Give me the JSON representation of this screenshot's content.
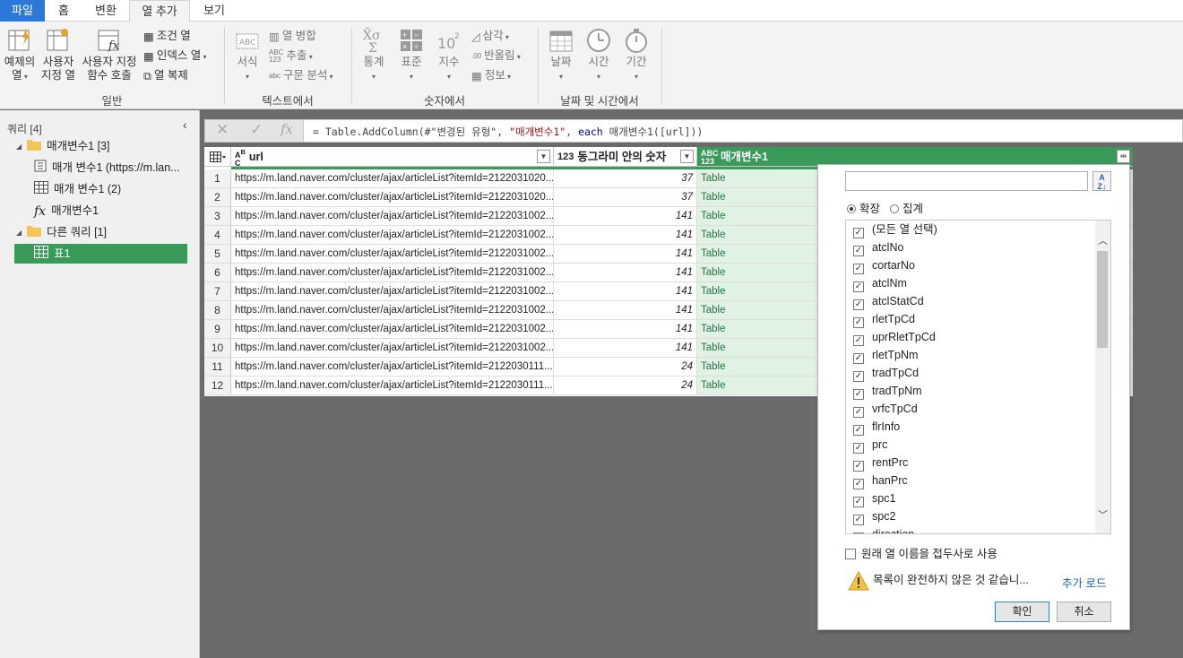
{
  "tabs": [
    {
      "label": "파일"
    },
    {
      "label": "홈"
    },
    {
      "label": "변환"
    },
    {
      "label": "열 추가"
    },
    {
      "label": "보기"
    }
  ],
  "ribbon": {
    "general": {
      "example_col": "예제의\n열",
      "custom_col": "사용자\n지정 열",
      "invoke_fn": "사용자 지정\n함수 호출",
      "conditional": "조건 열",
      "index": "인덱스 열",
      "duplicate": "열 복제",
      "label": "일반"
    },
    "text": {
      "format": "서식",
      "merge": "열 병합",
      "extract": "추출",
      "parse": "구문 분석",
      "label": "텍스트에서"
    },
    "number": {
      "stats": "통계",
      "standard": "표준",
      "scientific": "지수",
      "trig": "삼각",
      "rounding": "반올림",
      "info": "정보",
      "label": "숫자에서"
    },
    "datetime": {
      "date": "날짜",
      "time": "시간",
      "duration": "기간",
      "label": "날짜 및 시간에서"
    }
  },
  "queries": {
    "title": "쿼리 [4]",
    "groups": [
      {
        "label": "매개변수1 [3]"
      },
      {
        "label": "다른 쿼리 [1]"
      }
    ],
    "items": [
      {
        "label": "매개 변수1 (https://m.lan..."
      },
      {
        "label": "매개 변수1 (2)"
      },
      {
        "label": "매개변수1"
      },
      {
        "label": "표1"
      }
    ]
  },
  "formula": {
    "p1": "= Table.AddColumn(#\"변경된 유형\", ",
    "p2": "\"매개변수1\"",
    "p3": ", ",
    "p4": "each",
    "p5": " 매개변수1([url]))"
  },
  "table": {
    "columns": [
      {
        "type": "ABC",
        "name": "url"
      },
      {
        "type": "123",
        "name": "동그라미 안의 숫자"
      },
      {
        "type": "ABC 123",
        "name": "매개변수1"
      }
    ],
    "rows": [
      {
        "n": "1",
        "url": "https://m.land.naver.com/cluster/ajax/articleList?itemId=2122031020...",
        "num": "37",
        "val": "Table"
      },
      {
        "n": "2",
        "url": "https://m.land.naver.com/cluster/ajax/articleList?itemId=2122031020...",
        "num": "37",
        "val": "Table"
      },
      {
        "n": "3",
        "url": "https://m.land.naver.com/cluster/ajax/articleList?itemId=2122031002...",
        "num": "141",
        "val": "Table"
      },
      {
        "n": "4",
        "url": "https://m.land.naver.com/cluster/ajax/articleList?itemId=2122031002...",
        "num": "141",
        "val": "Table"
      },
      {
        "n": "5",
        "url": "https://m.land.naver.com/cluster/ajax/articleList?itemId=2122031002...",
        "num": "141",
        "val": "Table"
      },
      {
        "n": "6",
        "url": "https://m.land.naver.com/cluster/ajax/articleList?itemId=2122031002...",
        "num": "141",
        "val": "Table"
      },
      {
        "n": "7",
        "url": "https://m.land.naver.com/cluster/ajax/articleList?itemId=2122031002...",
        "num": "141",
        "val": "Table"
      },
      {
        "n": "8",
        "url": "https://m.land.naver.com/cluster/ajax/articleList?itemId=2122031002...",
        "num": "141",
        "val": "Table"
      },
      {
        "n": "9",
        "url": "https://m.land.naver.com/cluster/ajax/articleList?itemId=2122031002...",
        "num": "141",
        "val": "Table"
      },
      {
        "n": "10",
        "url": "https://m.land.naver.com/cluster/ajax/articleList?itemId=2122031002...",
        "num": "141",
        "val": "Table"
      },
      {
        "n": "11",
        "url": "https://m.land.naver.com/cluster/ajax/articleList?itemId=2122030111...",
        "num": "24",
        "val": "Table"
      },
      {
        "n": "12",
        "url": "https://m.land.naver.com/cluster/ajax/articleList?itemId=2122030111...",
        "num": "24",
        "val": "Table"
      }
    ]
  },
  "popup": {
    "search_value": "",
    "sort": "A↓Z",
    "expand": "확장",
    "aggregate": "집계",
    "columns": [
      "(모든 열 선택)",
      "atclNo",
      "cortarNo",
      "atclNm",
      "atclStatCd",
      "rletTpCd",
      "uprRletTpCd",
      "rletTpNm",
      "tradTpCd",
      "tradTpNm",
      "vrfcTpCd",
      "flrInfo",
      "prc",
      "rentPrc",
      "hanPrc",
      "spc1",
      "spc2",
      "direction"
    ],
    "use_prefix": "원래 열 이름을 접두사로 사용",
    "warning": "목록이 완전하지 않은 것 같습니...",
    "load_more": "추가 로드",
    "ok": "확인",
    "cancel": "취소"
  },
  "colors": {
    "accent": "#3a9a5a",
    "file_tab": "#2b78d8",
    "table_cell_bg": "#dff2e4",
    "link": "#1a5fb4"
  }
}
